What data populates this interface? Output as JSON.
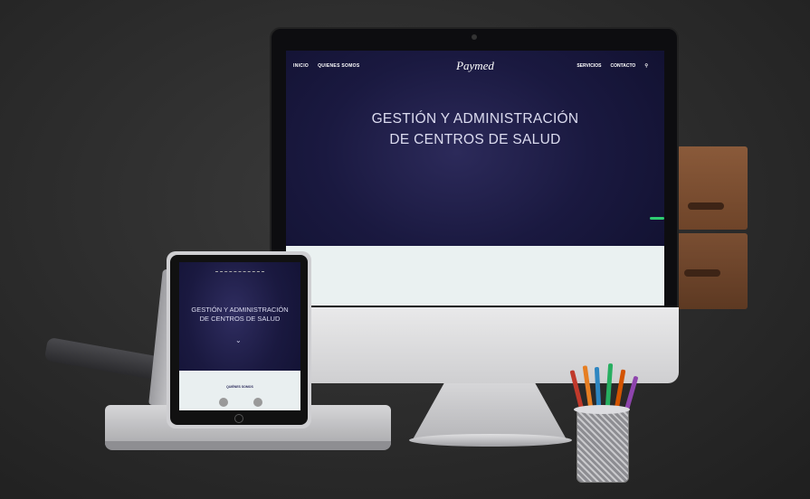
{
  "imac_site": {
    "nav_left": [
      "INICIO",
      "QUIENES SOMOS"
    ],
    "logo": "Paymed",
    "nav_right": [
      "SERVICIOS",
      "CONTACTO"
    ],
    "search_icon": "search-icon",
    "hero_line1": "GESTIÓN Y ADMINISTRACIÓN",
    "hero_line2": "DE CENTROS DE SALUD"
  },
  "tablet_site": {
    "hero_line1": "GESTIÓN Y ADMINISTRACIÓN",
    "hero_line2": "DE CENTROS DE SALUD",
    "section_title": "QUIÉNES SOMOS",
    "chevron_icon": "chevron-down-icon"
  },
  "colors": {
    "background": "#2b2b2b",
    "screen_bg": "#1a1940",
    "accent_green": "#2ecc71",
    "section_bg": "#eaf1f1"
  }
}
